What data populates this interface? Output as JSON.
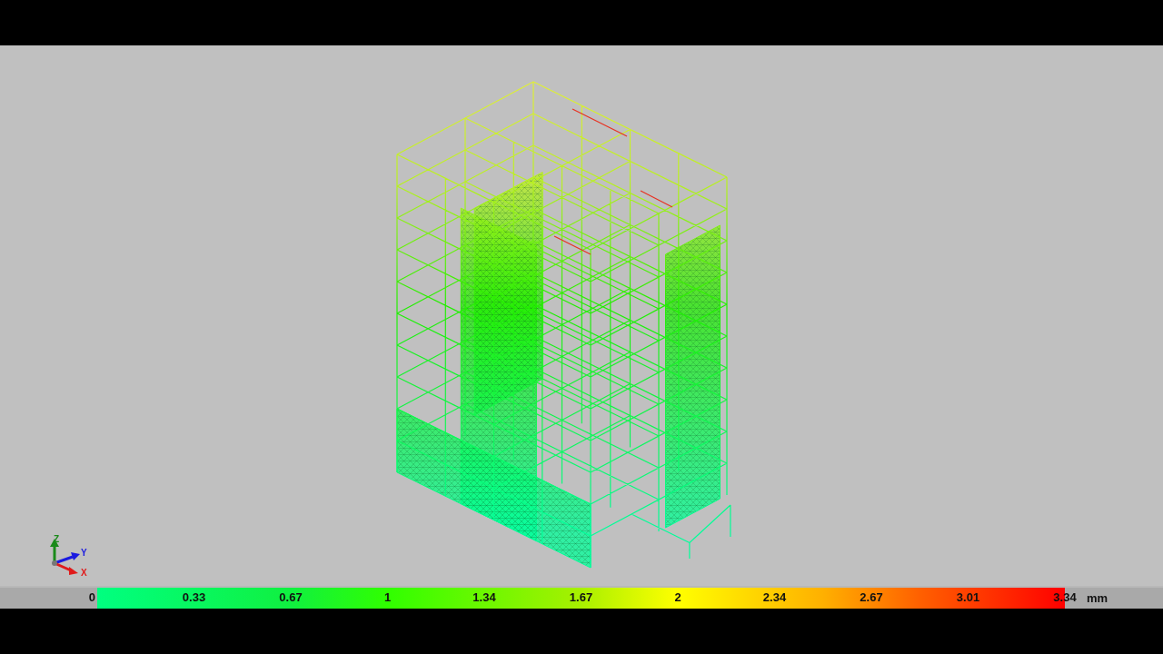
{
  "viewport": {
    "axes": [
      "Z",
      "Y",
      "X"
    ]
  },
  "legend": {
    "labels": [
      "0",
      "0.33",
      "0.67",
      "1",
      "1.34",
      "1.67",
      "2",
      "2.34",
      "2.67",
      "3.01",
      "3.34"
    ],
    "unit": "mm"
  }
}
